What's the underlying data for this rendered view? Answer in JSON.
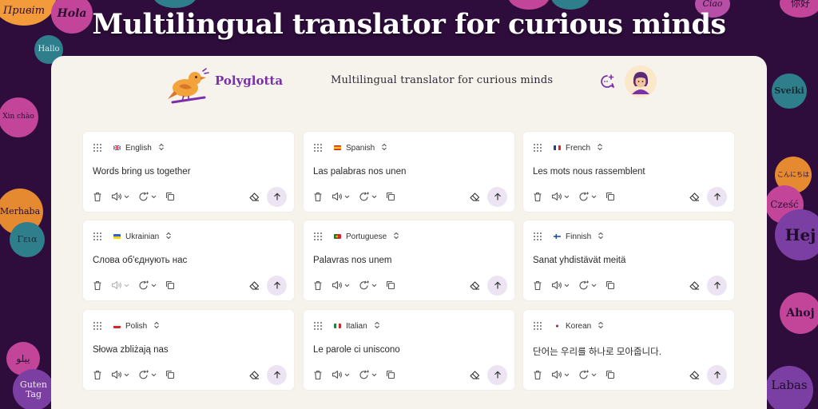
{
  "headline": "Multilingual translator for curious minds",
  "app": {
    "brand": "Polyglotta",
    "subtitle": "Multilingual translator for curious minds",
    "icons": {
      "logo": "bird-logo-icon",
      "chat": "chat-sparkle-icon",
      "avatar": "user-avatar"
    }
  },
  "bubbles": [
    {
      "text": "Привіт",
      "color": "#f39a3b"
    },
    {
      "text": "Hola",
      "color": "#c2459a"
    },
    {
      "text": "Hallo",
      "color": "#2e7e8c"
    },
    {
      "text": "Xin chào",
      "color": "#c2459a"
    },
    {
      "text": "Merhaba",
      "color": "#e58a31"
    },
    {
      "text": "Γεια",
      "color": "#2e7e8c"
    },
    {
      "text": "ییلو",
      "color": "#c2459a"
    },
    {
      "text": "Guten Tag",
      "color": "#7b3fa4"
    },
    {
      "text": "Ciao",
      "color": "#b84fa6"
    },
    {
      "text": "你好",
      "color": "#c2459a"
    },
    {
      "text": "Sveiki",
      "color": "#2e7e8c"
    },
    {
      "text": "こんにちは",
      "color": "#e58a31"
    },
    {
      "text": "Cześć",
      "color": "#c2459a"
    },
    {
      "text": "Hej",
      "color": "#7b3fa4"
    },
    {
      "text": "Ahoj",
      "color": "#c2459a"
    },
    {
      "text": "Labas",
      "color": "#7b3fa4"
    }
  ],
  "cards": [
    {
      "lang": "English",
      "flag": "uk",
      "text": "Words bring us together"
    },
    {
      "lang": "Spanish",
      "flag": "es",
      "text": "Las palabras nos unen"
    },
    {
      "lang": "French",
      "flag": "fr",
      "text": "Les mots nous rassemblent"
    },
    {
      "lang": "Ukrainian",
      "flag": "ua",
      "text": "Слова об'єднують нас"
    },
    {
      "lang": "Portuguese",
      "flag": "pt",
      "text": "Palavras nos unem"
    },
    {
      "lang": "Finnish",
      "flag": "fi",
      "text": "Sanat yhdistävät meitä"
    },
    {
      "lang": "Polish",
      "flag": "pl",
      "text": "Słowa zbliżają nas"
    },
    {
      "lang": "Italian",
      "flag": "it",
      "text": "Le parole ci uniscono"
    },
    {
      "lang": "Korean",
      "flag": "kr",
      "text": "단어는 우리를 하나로 모아줍니다."
    }
  ],
  "colors": {
    "accent": "#7a2fa8",
    "panel": "#f6f3ec",
    "background": "#2e0d3c",
    "send_bg": "#ece4f3"
  }
}
